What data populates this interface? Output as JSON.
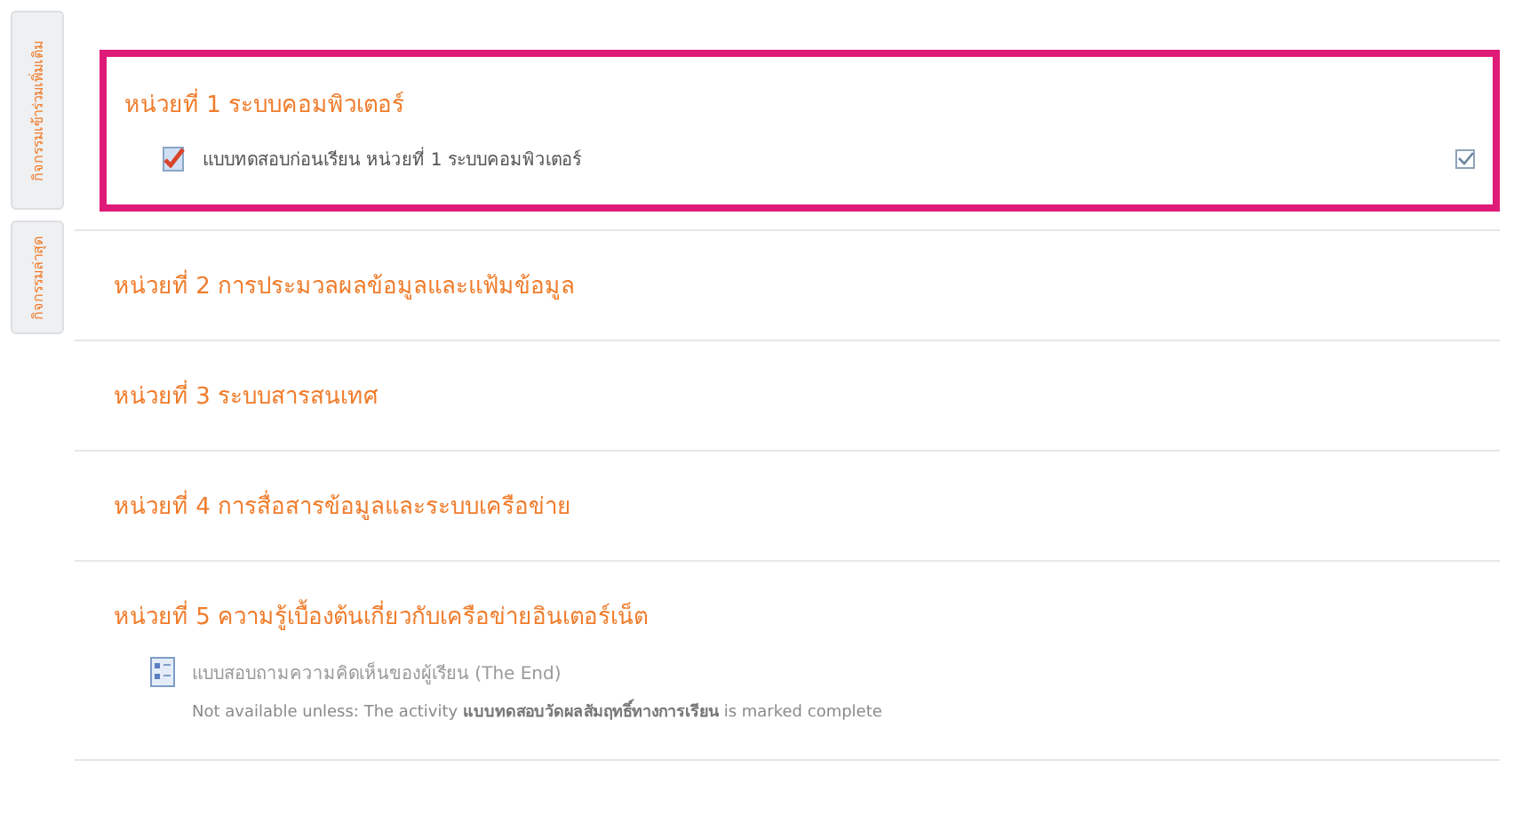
{
  "side_tabs": [
    {
      "label": "กิจกรรมเข้าร่วมเพิ่มเติม"
    },
    {
      "label": "กิจกรรมล่าสุด"
    }
  ],
  "sections": [
    {
      "title": "หน่วยที่ 1 ระบบคอมพิวเตอร์",
      "highlighted": true,
      "activities": [
        {
          "kind": "quiz",
          "name": "แบบทดสอบก่อนเรียน หน่วยที่ 1 ระบบคอมพิวเตอร์",
          "completed": true
        }
      ]
    },
    {
      "title": "หน่วยที่ 2 การประมวลผลข้อมูลและแฟ้มข้อมูล",
      "highlighted": false
    },
    {
      "title": "หน่วยที่ 3 ระบบสารสนเทศ",
      "highlighted": false
    },
    {
      "title": "หน่วยที่ 4 การสื่อสารข้อมูลและระบบเครือข่าย",
      "highlighted": false
    },
    {
      "title": "หน่วยที่ 5 ความรู้เบื้องต้นเกี่ยวกับเครือข่ายอินเตอร์เน็ต",
      "highlighted": false,
      "activities": [
        {
          "kind": "feedback",
          "name": "แบบสอบถามความคิดเห็นของผู้เรียน (The End)",
          "restriction": "Not available unless: The activity **แบบทดสอบวัดผลสัมฤทธิ์ทางการเรียน** is marked complete"
        }
      ]
    }
  ]
}
